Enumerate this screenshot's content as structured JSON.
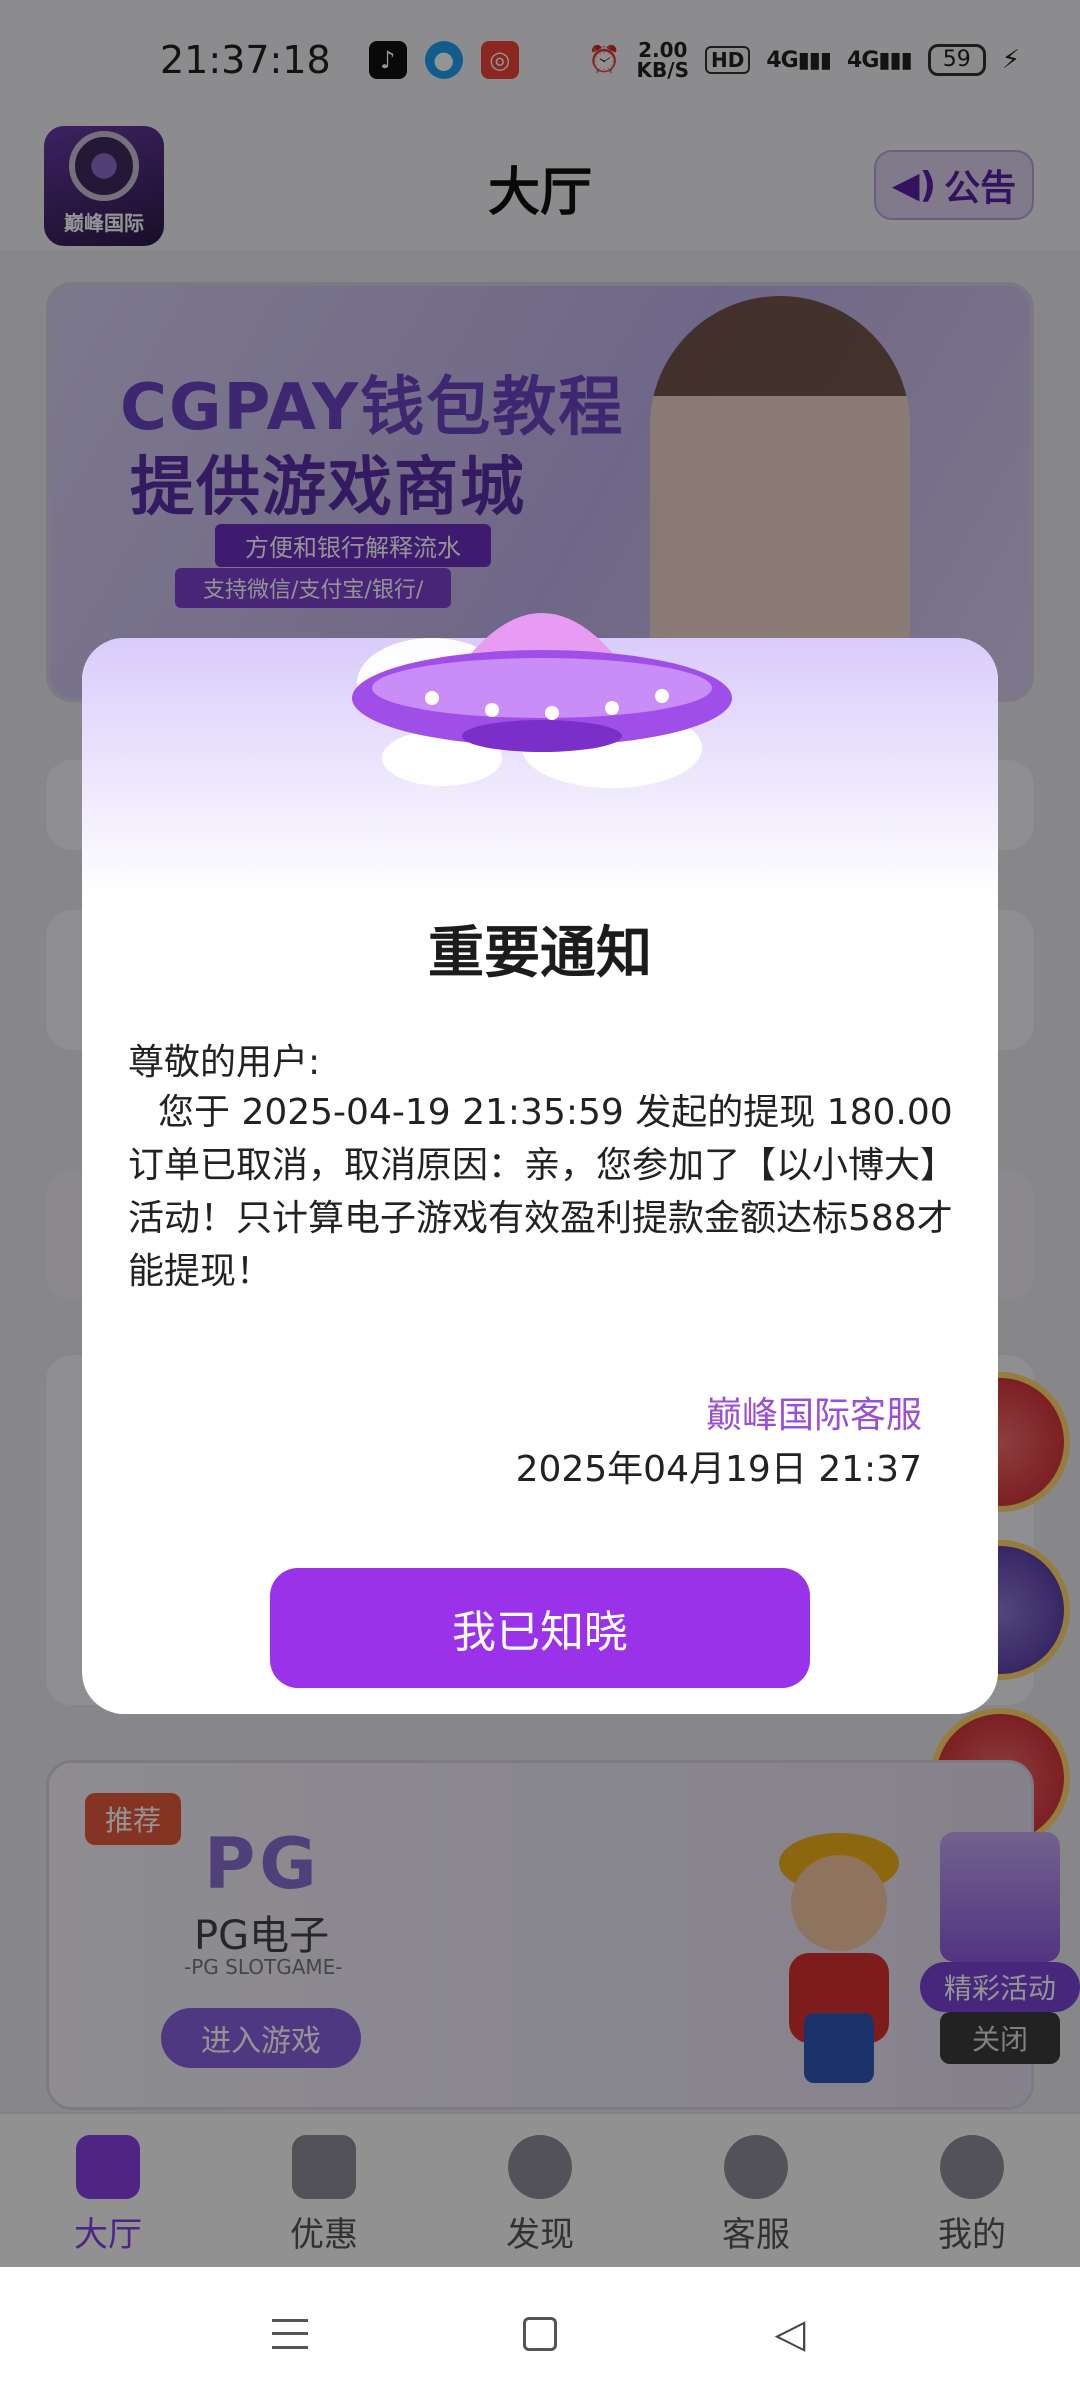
{
  "status_bar": {
    "time": "21:37:18",
    "net_speed_value": "2.00",
    "net_speed_unit": "KB/S",
    "hd_label": "HD",
    "signal1": "4G",
    "signal2": "4G",
    "battery": "59"
  },
  "header": {
    "logo_text": "巅峰国际",
    "title": "大厅",
    "notice_label": "公告"
  },
  "banner": {
    "line1": "CGPAY钱包教程",
    "line2": "提供游戏商城",
    "line3": "方便和银行解释流水",
    "line4": "支持微信/支付宝/银行/"
  },
  "promo": {
    "tag": "推荐",
    "brand": "PG",
    "title": "PG电子",
    "subtitle": "-PG SLOTGAME-",
    "enter_label": "进入游戏"
  },
  "float_gift": {
    "label": "精彩活动",
    "close": "关闭"
  },
  "bottom_nav": [
    {
      "label": "大厅",
      "active": true
    },
    {
      "label": "优惠",
      "active": false
    },
    {
      "label": "发现",
      "active": false
    },
    {
      "label": "客服",
      "active": false
    },
    {
      "label": "我的",
      "active": false
    }
  ],
  "modal": {
    "title": "重要通知",
    "greeting": "尊敬的用户:",
    "body": "您于 2025-04-19 21:35:59 发起的提现 180.00 订单已取消，取消原因：亲，您参加了【以小博大】活动！只计算电子游戏有效盈利提款金额达标588才能提现！",
    "signature": "巅峰国际客服",
    "date": "2025年04月19日 21:37",
    "confirm_label": "我已知晓"
  },
  "colors": {
    "accent": "#9a32ea",
    "signature": "#9b4ed6",
    "nav_active": "#8a3fe6"
  }
}
